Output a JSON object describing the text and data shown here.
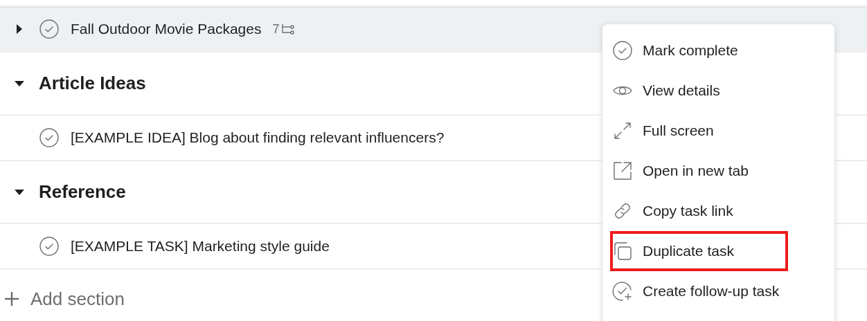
{
  "rows": [
    {
      "kind": "task",
      "title": "Fall Outdoor Movie Packages",
      "expanded": false,
      "subtask_count": "7",
      "selected": true
    },
    {
      "kind": "section",
      "title": "Article Ideas",
      "expanded": true
    },
    {
      "kind": "task",
      "title": "[EXAMPLE IDEA] Blog about finding relevant influencers?",
      "selected": false
    },
    {
      "kind": "section",
      "title": "Reference",
      "expanded": true
    },
    {
      "kind": "task",
      "title": "[EXAMPLE TASK] Marketing style guide",
      "selected": false
    }
  ],
  "add_section": {
    "label": "Add section"
  },
  "context_menu": {
    "items": [
      {
        "kind": "check",
        "label": "Mark complete",
        "highlighted": false
      },
      {
        "kind": "eye",
        "label": "View details",
        "highlighted": false
      },
      {
        "kind": "expand",
        "label": "Full screen",
        "highlighted": false
      },
      {
        "kind": "external",
        "label": "Open in new tab",
        "highlighted": false
      },
      {
        "kind": "link",
        "label": "Copy task link",
        "highlighted": false
      },
      {
        "kind": "duplicate",
        "label": "Duplicate task",
        "highlighted": true
      },
      {
        "kind": "followup",
        "label": "Create follow-up task",
        "highlighted": false
      }
    ]
  }
}
